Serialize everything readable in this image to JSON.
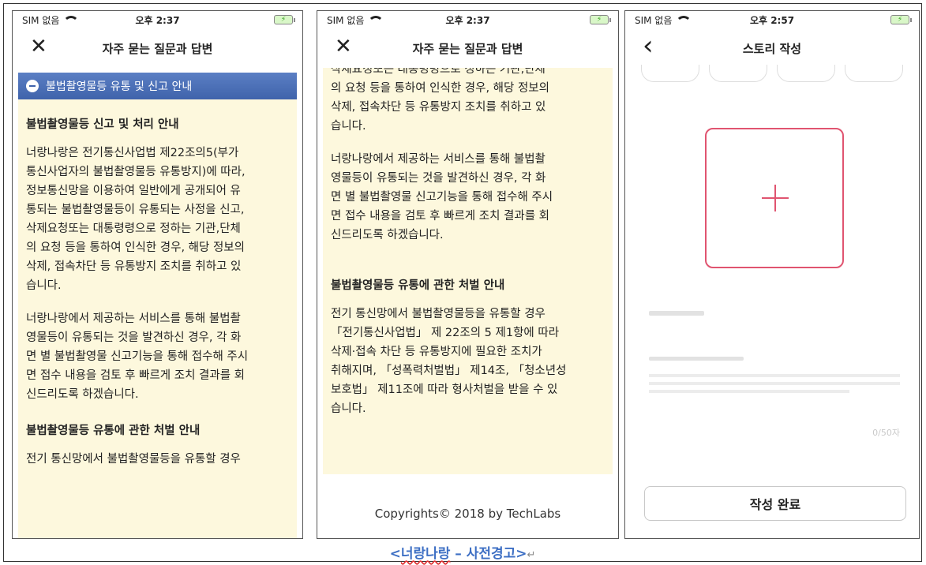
{
  "screens": [
    {
      "status": {
        "carrier": "SIM 없음",
        "time": "오후 2:37",
        "battery": "⚡"
      },
      "nav": {
        "title": "자주 묻는 질문과 답변",
        "left_icon": "close-icon",
        "left_glyph": "✕"
      },
      "section_bar": "불법촬영물등 유통 및 신고 안내",
      "heading1": "불법촬영물등 신고 및 처리 안내",
      "para1": "너랑나랑은 전기통신사업법 제22조의5(부가\n통신사업자의 불법촬영물등 유통방지)에 따라,\n정보통신망을 이용하여 일반에게 공개되어 유\n통되는 불법촬영물등이 유통되는 사정을 신고,\n삭제요청또는 대통령령으로 정하는 기관,단체\n의 요청 등을 통하여 인식한 경우, 해당 정보의\n삭제, 접속차단 등 유통방지 조치를 취하고 있\n습니다.",
      "para2": "너랑나랑에서 제공하는 서비스를 통해 불법촬\n영물등이 유통되는 것을 발견하신 경우, 각 화\n면 별 불법촬영물 신고기능을 통해 접수해 주시\n면 접수 내용을 검토 후 빠르게 조치 결과를 회\n신드리도록 하겠습니다.",
      "heading2": "불법촬영물등 유통에 관한 처벌 안내",
      "para3": "전기 통신망에서 불법촬영물등을 유통할 경우"
    },
    {
      "status": {
        "carrier": "SIM 없음",
        "time": "오후 2:37",
        "battery": "⚡"
      },
      "nav": {
        "title": "자주 묻는 질문과 답변",
        "left_icon": "close-icon",
        "left_glyph": "✕"
      },
      "para1": "삭제요청또는 대통령령으로 정하는 기관,단체\n의 요청 등을 통하여 인식한 경우, 해당 정보의\n삭제, 접속차단 등 유통방지 조치를 취하고 있\n습니다.",
      "para2": "너랑나랑에서 제공하는 서비스를 통해 불법촬\n영물등이 유통되는 것을 발견하신 경우, 각 화\n면 별 불법촬영물 신고기능을 통해 접수해 주시\n면 접수 내용을 검토 후 빠르게 조치 결과를 회\n신드리도록 하겠습니다.",
      "heading2": "불법촬영물등 유통에 관한 처벌 안내",
      "para3": "전기 통신망에서 불법촬영물등을 유통할 경우\n「전기통신사업법」 제 22조의 5 제1항에 따라\n삭제·접속 차단 등 유통방지에 필요한 조치가\n취해지며, 「성폭력처벌법」 제14조, 「청소년성\n보호법」 제11조에 따라 형사처벌을 받을 수 있\n습니다.",
      "footer": "Copyrights© 2018 by TechLabs"
    },
    {
      "status": {
        "carrier": "SIM 없음",
        "time": "오후 2:57",
        "battery": "⚡"
      },
      "nav": {
        "title": "스토리 작성",
        "left_icon": "back-chevron-icon",
        "left_glyph": "‹"
      },
      "counter": "0/50자",
      "submit": "작성 완료"
    }
  ],
  "caption": {
    "prefix": "<",
    "name": "너랑나랑",
    "rest": " – 사전경고>",
    "mark": "↵"
  },
  "colors": {
    "section_bar": "#4a6fb8",
    "content_bg": "#fdf8dd",
    "accent": "#e05470",
    "caption": "#3d6fc4"
  }
}
